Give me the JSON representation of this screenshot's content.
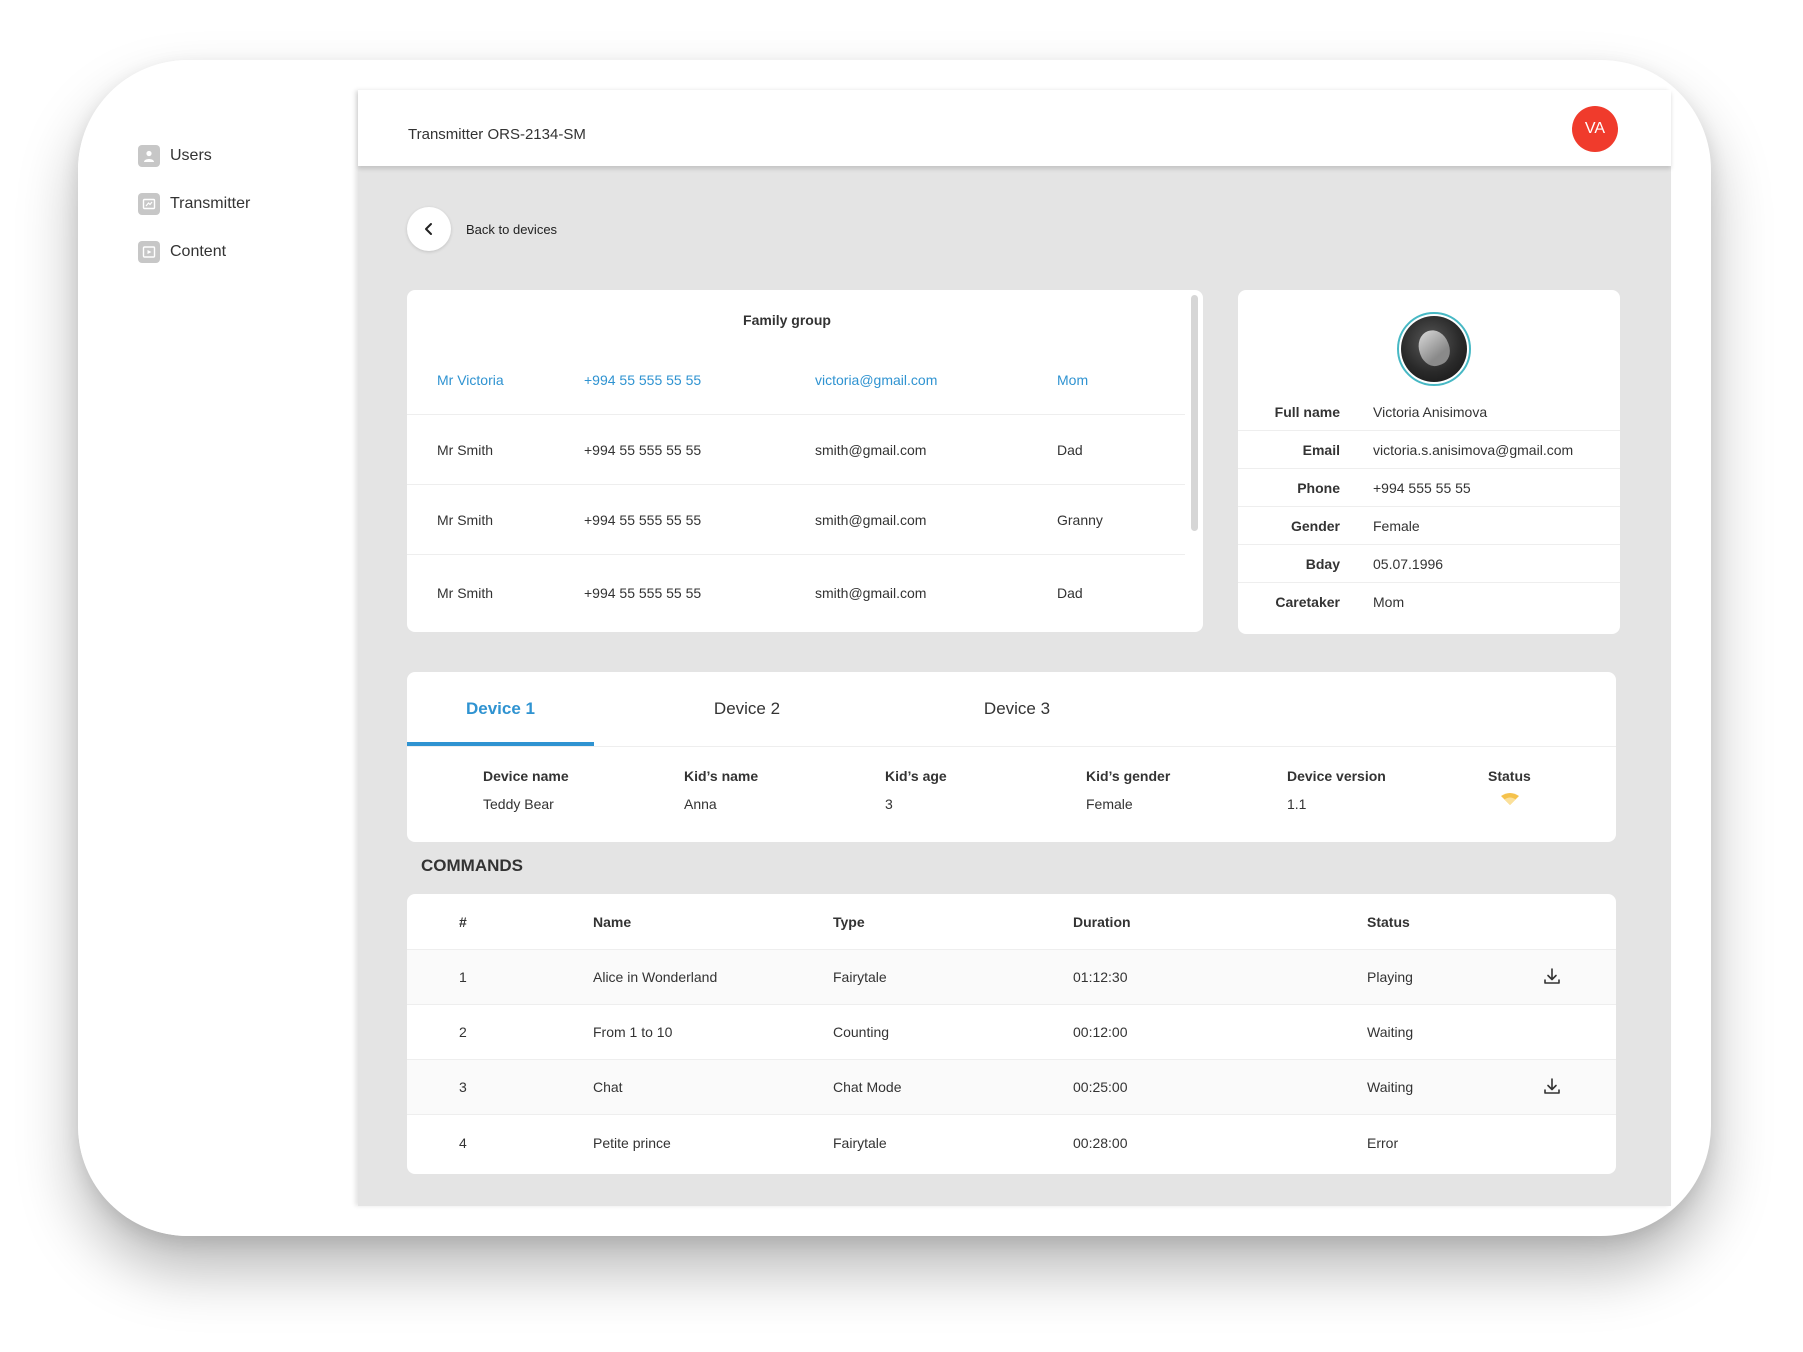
{
  "sidebar": {
    "items": [
      {
        "label": "Users",
        "icon": "user-icon"
      },
      {
        "label": "Transmitter",
        "icon": "transmitter-icon"
      },
      {
        "label": "Content",
        "icon": "content-icon"
      }
    ]
  },
  "header": {
    "title": "Transmitter ORS-2134-SM",
    "avatar_initials": "VA",
    "avatar_color": "#f03b2c"
  },
  "back": {
    "label": "Back to devices"
  },
  "family": {
    "title": "Family group",
    "rows": [
      {
        "name": "Mr Victoria",
        "phone": "+994 55 555 55 55",
        "email": "victoria@gmail.com",
        "role": "Mom"
      },
      {
        "name": "Mr Smith",
        "phone": "+994 55 555 55 55",
        "email": "smith@gmail.com",
        "role": "Dad"
      },
      {
        "name": "Mr Smith",
        "phone": "+994 55 555 55 55",
        "email": "smith@gmail.com",
        "role": "Granny"
      },
      {
        "name": "Mr Smith",
        "phone": "+994 55 555 55 55",
        "email": "smith@gmail.com",
        "role": "Dad"
      }
    ]
  },
  "profile": {
    "fields": [
      {
        "label": "Full name",
        "value": "Victoria Anisimova"
      },
      {
        "label": "Email",
        "value": "victoria.s.anisimova@gmail.com"
      },
      {
        "label": "Phone",
        "value": "+994 555 55 55"
      },
      {
        "label": "Gender",
        "value": "Female"
      },
      {
        "label": "Bday",
        "value": "05.07.1996"
      },
      {
        "label": "Caretaker",
        "value": "Mom"
      }
    ]
  },
  "devices": {
    "tabs": [
      "Device 1",
      "Device 2",
      "Device 3"
    ],
    "active_tab": 0,
    "accent_color": "#2f93d1",
    "fields": [
      {
        "label": "Device name",
        "value": "Teddy Bear"
      },
      {
        "label": "Kid’s name",
        "value": "Anna"
      },
      {
        "label": "Kid’s age",
        "value": "3"
      },
      {
        "label": "Kid’s gender",
        "value": "Female"
      },
      {
        "label": "Device version",
        "value": "1.1"
      },
      {
        "label": "Status",
        "icon": "wifi-icon",
        "icon_color": "#f5c24c"
      }
    ]
  },
  "commands": {
    "title": "COMMANDS",
    "headers": [
      "#",
      "Name",
      "Type",
      "Duration",
      "Status"
    ],
    "rows": [
      {
        "num": "1",
        "name": "Alice in Wonderland",
        "type": "Fairytale",
        "duration": "01:12:30",
        "status": "Playing",
        "download": true
      },
      {
        "num": "2",
        "name": "From 1 to 10",
        "type": "Counting",
        "duration": "00:12:00",
        "status": "Waiting",
        "download": false
      },
      {
        "num": "3",
        "name": "Chat",
        "type": "Chat Mode",
        "duration": "00:25:00",
        "status": "Waiting",
        "download": true
      },
      {
        "num": "4",
        "name": "Petite prince",
        "type": "Fairytale",
        "duration": "00:28:00",
        "status": "Error",
        "download": false
      }
    ]
  }
}
